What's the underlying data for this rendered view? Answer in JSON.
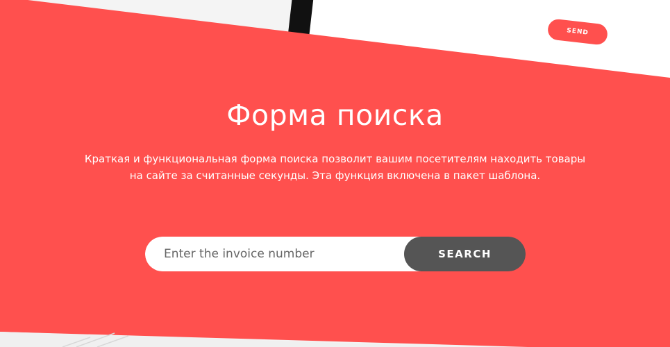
{
  "mockup": {
    "send_label": "SEND"
  },
  "hero": {
    "title": "Форма поиска",
    "description": "Краткая и функциональная форма поиска позволит вашим посетителям находить товары на сайте за считанные секунды. Эта функция включена в пакет шаблона."
  },
  "search": {
    "placeholder": "Enter the invoice number",
    "value": "",
    "button_label": "SEARCH"
  },
  "colors": {
    "accent": "#ff504e",
    "button": "#555555",
    "text_on_accent": "#ffffff"
  }
}
